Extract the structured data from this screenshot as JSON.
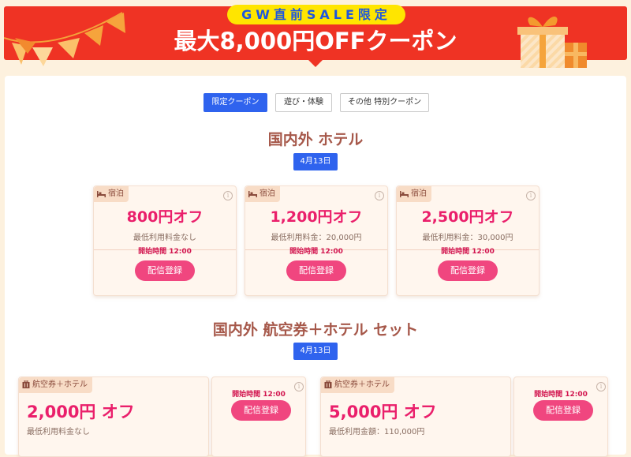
{
  "banner": {
    "badge": "GW直前SALE限定",
    "title": "最大8,000円OFFクーポン",
    "colors": {
      "red": "#ef3324",
      "badge_yellow": "#ffe500",
      "badge_text": "#1d56e0"
    }
  },
  "tabs": [
    {
      "label": "限定クーポン",
      "active": true
    },
    {
      "label": "遊び・体験",
      "active": false
    },
    {
      "label": "その他 特別クーポン",
      "active": false
    }
  ],
  "sections": [
    {
      "title": "国内外 ホテル",
      "date": "4月13日",
      "cards": [
        {
          "category": "宿泊",
          "discount": "800円オフ",
          "min_usage": "最低利用料金なし",
          "start_time": "開始時間 12:00",
          "button": "配信登録"
        },
        {
          "category": "宿泊",
          "discount": "1,200円オフ",
          "min_usage": "最低利用料金：20,000円",
          "start_time": "開始時間 12:00",
          "button": "配信登録"
        },
        {
          "category": "宿泊",
          "discount": "2,500円オフ",
          "min_usage": "最低利用料金：30,000円",
          "start_time": "開始時間 12:00",
          "button": "配信登録"
        }
      ]
    },
    {
      "title": "国内外 航空券＋ホテル セット",
      "date": "4月13日",
      "cards": [
        {
          "category": "航空券＋ホテル",
          "discount": "2,000円 オフ",
          "min_usage": "最低利用料金なし",
          "start_time": "開始時間 12:00",
          "button": "配信登録"
        },
        {
          "category": "航空券＋ホテル",
          "discount": "5,000円 オフ",
          "min_usage": "最低利用金額：110,000円",
          "start_time": "開始時間 12:00",
          "button": "配信登録"
        }
      ]
    }
  ],
  "icons": {
    "hotel": "bed-icon",
    "bundle": "luggage-icon",
    "info": "info-icon"
  },
  "colors": {
    "accent_blue": "#2f63ee",
    "discount_pink": "#ea1f6b",
    "button_pink": "#f0467f",
    "title_brown": "#a6584a"
  }
}
